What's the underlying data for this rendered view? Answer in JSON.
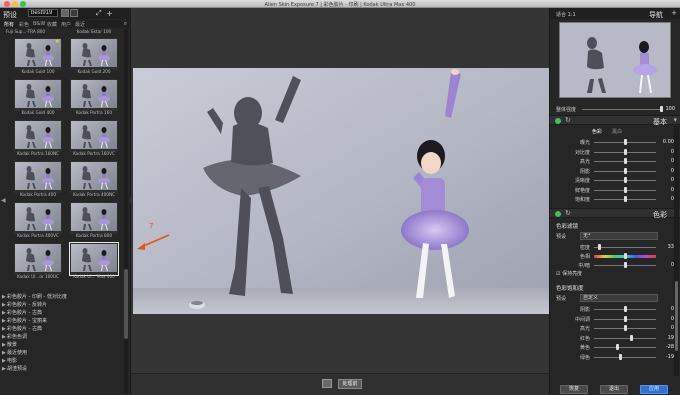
{
  "window": {
    "title": "Alien Skin Exposure 7 | 彩色胶片 - 印刷 | Kodak Ultra Max 400"
  },
  "left": {
    "panel_title": "预设",
    "search_value": "best919",
    "tabs": [
      "所有",
      "彩色",
      "B&W",
      "收藏",
      "用户",
      "最近"
    ],
    "top_captions": [
      "Fuji Sup...-TRA 800",
      "Kodak Ektar 100"
    ],
    "thumbs": [
      "Kodak Gold 100",
      "Kodak Gold 200",
      "Kodak Gold 400",
      "Kodak Portra 160",
      "Kodak Portra 160NC",
      "Kodak Portra 160VC",
      "Kodak Portra 400",
      "Kodak Portra 400NC",
      "Kodak Portra 400VC",
      "Kodak Portra 800",
      "Kodak Ul...or 100UC",
      "Kodak Ul... Max 400"
    ],
    "categories": [
      "彩色胶片 - 印刷 - 低对比度",
      "彩色胶片 - 反转片",
      "彩色胶片 - 古典",
      "彩色胶片 - 宝丽来",
      "彩色胶片 - 古典",
      "彩色色调",
      "散景",
      "最近使用",
      "电影",
      "胡渣预设"
    ]
  },
  "center": {
    "annotation": "7",
    "process_label": "处理前"
  },
  "right": {
    "zoom": "适合  1:1",
    "nav_title": "导航",
    "overall_strength": {
      "label": "整体强度",
      "value": "100"
    },
    "basic": {
      "title": "基本",
      "tabs": [
        "色彩",
        "黑白"
      ],
      "rows": [
        {
          "label": "曝光",
          "value": "0.00"
        },
        {
          "label": "对比度",
          "value": "0"
        },
        {
          "label": "高光",
          "value": "0"
        },
        {
          "label": "阴影",
          "value": "0"
        },
        {
          "label": "清晰度",
          "value": "0"
        },
        {
          "label": "鲜艳度",
          "value": "0"
        },
        {
          "label": "饱和度",
          "value": "0"
        }
      ]
    },
    "color": {
      "title": "色彩",
      "filter_title": "色彩滤镜",
      "preset_label": "预设",
      "preset_value": "无*",
      "rows": [
        {
          "label": "密度",
          "value": "33"
        },
        {
          "label": "色相",
          "value": ""
        },
        {
          "label": "中/暗",
          "value": "0"
        }
      ],
      "preserve_label": "保持亮度",
      "saturation_title": "色彩饱和度",
      "sat_preset_value": "自定义",
      "sat_rows": [
        {
          "label": "阴影",
          "value": "0"
        },
        {
          "label": "中间调",
          "value": "0"
        },
        {
          "label": "高光",
          "value": "0"
        },
        {
          "label": "红色",
          "value": "19"
        },
        {
          "label": "黄色",
          "value": "-28"
        },
        {
          "label": "绿色",
          "value": "-19"
        }
      ]
    },
    "footer": {
      "restore": "恢复",
      "cancel": "退出",
      "apply": "应用"
    }
  },
  "colors": {
    "accent": "#2d74d6",
    "annotation": "#e8541e",
    "power": "#3fc15a"
  }
}
